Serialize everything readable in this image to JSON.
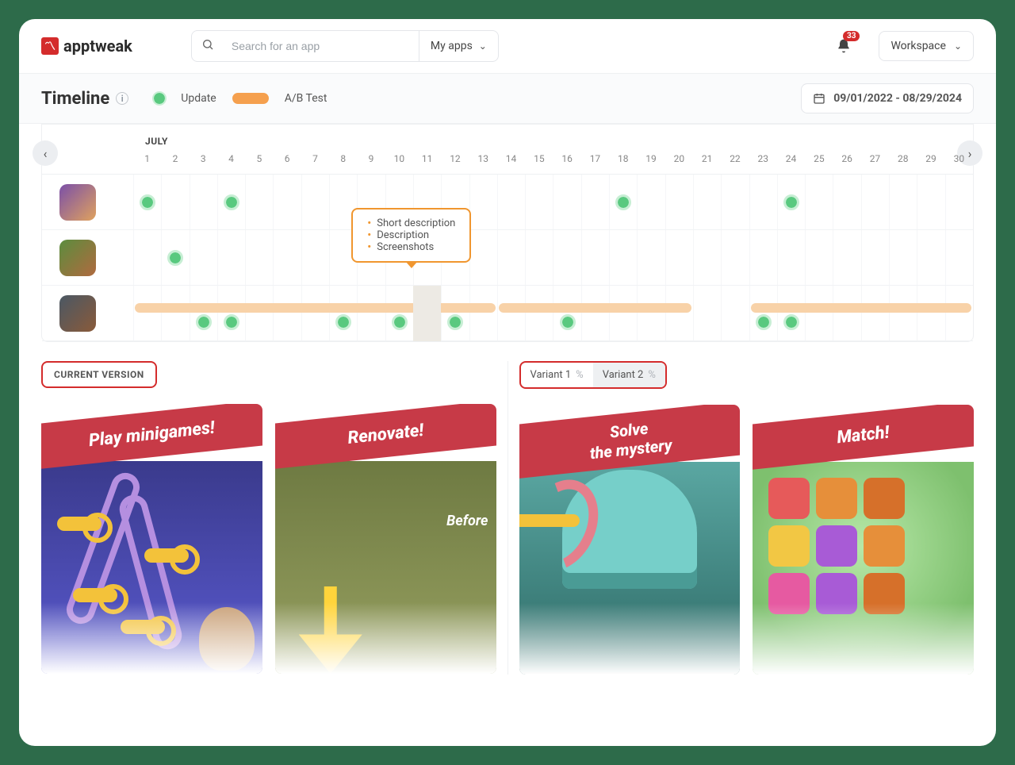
{
  "brand": "apptweak",
  "search": {
    "placeholder": "Search for an app",
    "myapps_label": "My apps"
  },
  "notifications": {
    "count": "33"
  },
  "workspace_label": "Workspace",
  "page": {
    "title": "Timeline",
    "legend_update": "Update",
    "legend_ab": "A/B Test",
    "date_range": "09/01/2022 - 08/29/2024"
  },
  "timeline": {
    "month": "JULY",
    "days": [
      "1",
      "2",
      "3",
      "4",
      "5",
      "6",
      "7",
      "8",
      "9",
      "10",
      "11",
      "12",
      "13",
      "14",
      "15",
      "16",
      "17",
      "18",
      "19",
      "20",
      "21",
      "22",
      "23",
      "24",
      "25",
      "26",
      "27",
      "28",
      "29",
      "30"
    ],
    "tooltip": [
      "Short description",
      "Description",
      "Screenshots"
    ],
    "rows": [
      {
        "icon_bg": "linear-gradient(135deg,#7a4fa8,#e0a25e)",
        "updates": [
          1,
          4,
          18,
          24
        ],
        "ab_bars": []
      },
      {
        "icon_bg": "linear-gradient(135deg,#5b8d3e,#b06a3f)",
        "updates": [
          2
        ],
        "ab_bars": []
      },
      {
        "icon_bg": "linear-gradient(135deg,#4a5864,#8a5a3a)",
        "updates": [
          3,
          4,
          8,
          10,
          12,
          16,
          23,
          24
        ],
        "ab_bars": [
          [
            1,
            13
          ],
          [
            14,
            20
          ],
          [
            23,
            30
          ]
        ]
      }
    ]
  },
  "variants": {
    "current_label": "CURRENT VERSION",
    "v1_label": "Variant 1",
    "v2_label": "Variant 2",
    "pct": "%",
    "shots": {
      "left": [
        "Play minigames!",
        "Renovate!"
      ],
      "right": [
        "Solve\nthe mystery",
        "Match!"
      ]
    },
    "before_label": "Before"
  }
}
